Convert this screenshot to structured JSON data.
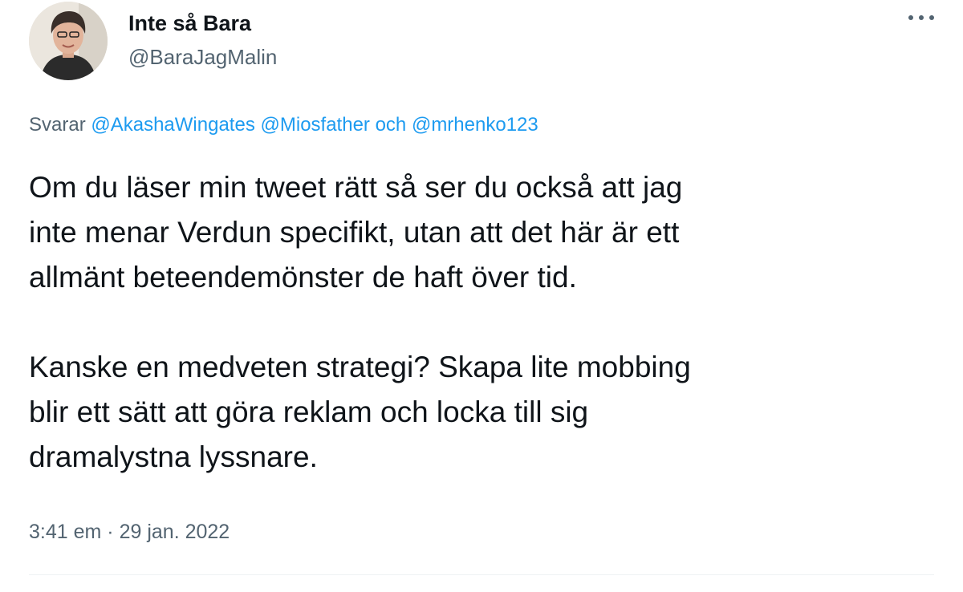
{
  "author": {
    "display_name": "Inte så Bara",
    "handle": "@BaraJagMalin"
  },
  "reply": {
    "prefix": "Svarar",
    "mention_1": "@AkashaWingates",
    "mention_2": "@Miosfather",
    "conjunction": "och",
    "mention_3": "@mrhenko123"
  },
  "tweet": {
    "paragraph_1": "Om du läser min tweet rätt så ser du också att jag\ninte menar Verdun specifikt, utan att det här är ett\nallmänt beteendemönster de haft över tid.",
    "paragraph_2": "Kanske en medveten strategi? Skapa lite mobbing\nblir ett sätt att göra reklam och locka till sig\ndramalystna lyssnare."
  },
  "meta": {
    "time": "3:41 em",
    "separator": "·",
    "date": "29 jan. 2022"
  },
  "colors": {
    "text": "#0f1419",
    "secondary": "#536471",
    "link": "#1d9bf0",
    "divider": "#eff3f4"
  },
  "icons": {
    "more": "more-horizontal-icon"
  }
}
